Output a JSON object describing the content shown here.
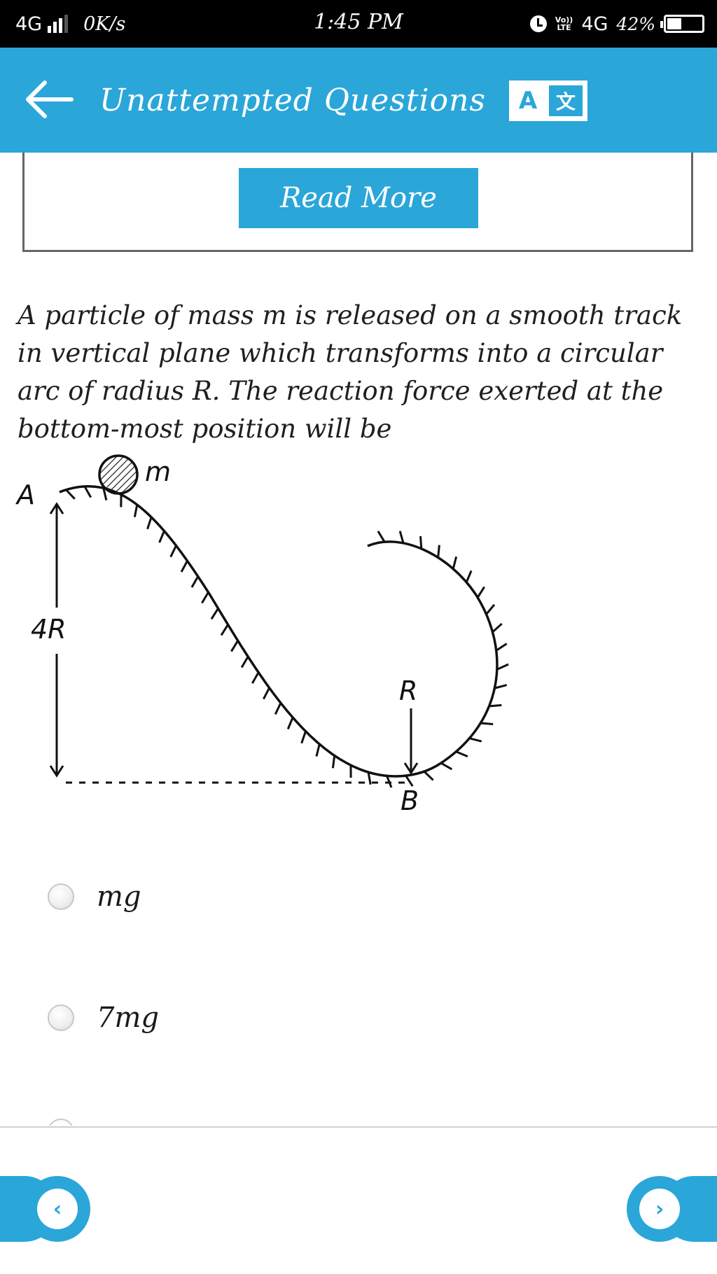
{
  "status_bar": {
    "network": "4G",
    "speed": "0K/s",
    "time": "1:45 PM",
    "volte_line1": "Vo))",
    "volte_line2": "LTE",
    "network_right": "4G",
    "battery_pct": "42%",
    "battery_level": 0.42
  },
  "header": {
    "title": "Unattempted Questions",
    "translate_a": "A",
    "translate_zh": "文"
  },
  "read_more": {
    "label": "Read More"
  },
  "question": {
    "text_before_m": "A particle of mass ",
    "var_m": "m",
    "text_before_r": " is released on a smooth track in vertical plane which transforms into a circular arc of radius ",
    "var_r": "R",
    "text_after": ". The reaction force exerted at the bottom-most position will be"
  },
  "diagram": {
    "label_m": "m",
    "label_a": "A",
    "label_height": "4R",
    "label_r": "R",
    "label_b": "B"
  },
  "options": [
    {
      "label": "mg"
    },
    {
      "label": "7mg"
    }
  ],
  "nav": {
    "prev": "‹",
    "next": "›"
  },
  "colors": {
    "accent": "#2aa6d9"
  }
}
